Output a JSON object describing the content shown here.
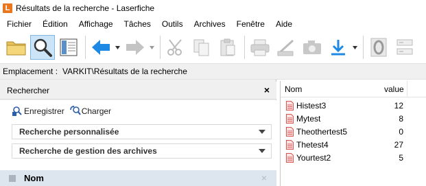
{
  "window": {
    "app_logo_letter": "L",
    "title": "Résultats de la recherche - Laserfiche"
  },
  "menu": {
    "items": [
      "Fichier",
      "Édition",
      "Affichage",
      "Tâches",
      "Outils",
      "Archives",
      "Fenêtre",
      "Aide"
    ]
  },
  "toolbar": {
    "buttons": [
      {
        "icon": "folder-icon"
      },
      {
        "icon": "magnifier-search-icon",
        "active": true
      },
      {
        "icon": "browse-panel-icon"
      },
      {
        "icon": "back-arrow-icon"
      },
      {
        "icon": "forward-arrow-icon",
        "disabled": true
      },
      {
        "icon": "cut-icon",
        "disabled": true
      },
      {
        "icon": "copy-icon",
        "disabled": true
      },
      {
        "icon": "paste-icon",
        "disabled": true
      },
      {
        "icon": "print-icon",
        "disabled": true
      },
      {
        "icon": "scan-icon",
        "disabled": true
      },
      {
        "icon": "camera-icon",
        "disabled": true
      },
      {
        "icon": "download-icon"
      },
      {
        "icon": "ocr-icon",
        "disabled": true
      },
      {
        "icon": "fields-icon",
        "disabled": true
      }
    ]
  },
  "location": {
    "label": "Emplacement :",
    "value": "VARKIT\\Résultats de la recherche"
  },
  "search_panel": {
    "title": "Rechercher",
    "close_glyph": "×",
    "save_label": "Enregistrer",
    "load_label": "Charger",
    "sections": [
      {
        "label": "Recherche personnalisée"
      },
      {
        "label": "Recherche de gestion des archives"
      }
    ],
    "name_criterion": {
      "label": "Nom",
      "close_glyph": "×"
    }
  },
  "results": {
    "columns": {
      "name": "Nom",
      "value": "value"
    },
    "rows": [
      {
        "name": "Histest3",
        "value": "12"
      },
      {
        "name": "Mytest",
        "value": "8"
      },
      {
        "name": "Theothertest5",
        "value": "0"
      },
      {
        "name": "Thetest4",
        "value": "27"
      },
      {
        "name": "Yourtest2",
        "value": "5"
      }
    ]
  },
  "colors": {
    "accent_blue": "#1e88e5",
    "logo_orange": "#e8771e",
    "active_button_bg": "#cce4f7",
    "document_icon_red": "#d9534f"
  }
}
